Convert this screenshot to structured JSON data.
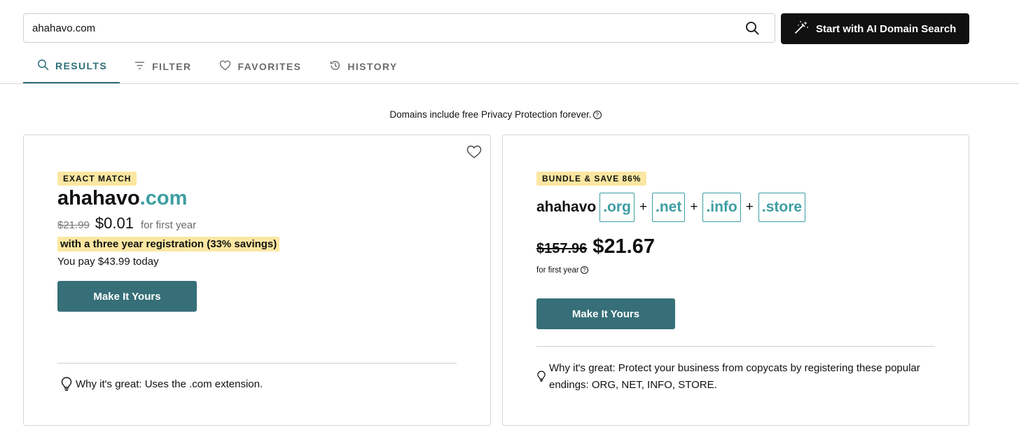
{
  "search": {
    "value": "ahahavo.com",
    "ai_button_label": "Start with AI Domain Search"
  },
  "tabs": [
    {
      "label": "RESULTS",
      "icon": "search-icon",
      "active": true
    },
    {
      "label": "FILTER",
      "icon": "filter-icon",
      "active": false
    },
    {
      "label": "FAVORITES",
      "icon": "heart-icon",
      "active": false
    },
    {
      "label": "HISTORY",
      "icon": "history-icon",
      "active": false
    }
  ],
  "privacy_note": "Domains include free Privacy Protection forever.",
  "exact_match": {
    "badge": "EXACT MATCH",
    "sld": "ahahavo",
    "tld": ".com",
    "old_price": "$21.99",
    "new_price": "$0.01",
    "period": "for first year",
    "savings": "with a three year registration (33% savings)",
    "pay_today": "You pay $43.99 today",
    "button_label": "Make It Yours",
    "why_great": "Why it's great: Uses the .com extension."
  },
  "bundle": {
    "badge": "BUNDLE & SAVE 86%",
    "sld": "ahahavo",
    "tlds": [
      ".org",
      ".net",
      ".info",
      ".store"
    ],
    "plus": "+",
    "old_price": "$157.96",
    "new_price": "$21.67",
    "period": "for first year",
    "button_label": "Make It Yours",
    "why_great": "Why it's great: Protect your business from copycats by registering these popular endings: ORG, NET, INFO, STORE."
  },
  "colors": {
    "accent": "#366f78",
    "tld": "#3d9ea3",
    "badge": "#fbe7a1",
    "dark_button": "#111111"
  }
}
